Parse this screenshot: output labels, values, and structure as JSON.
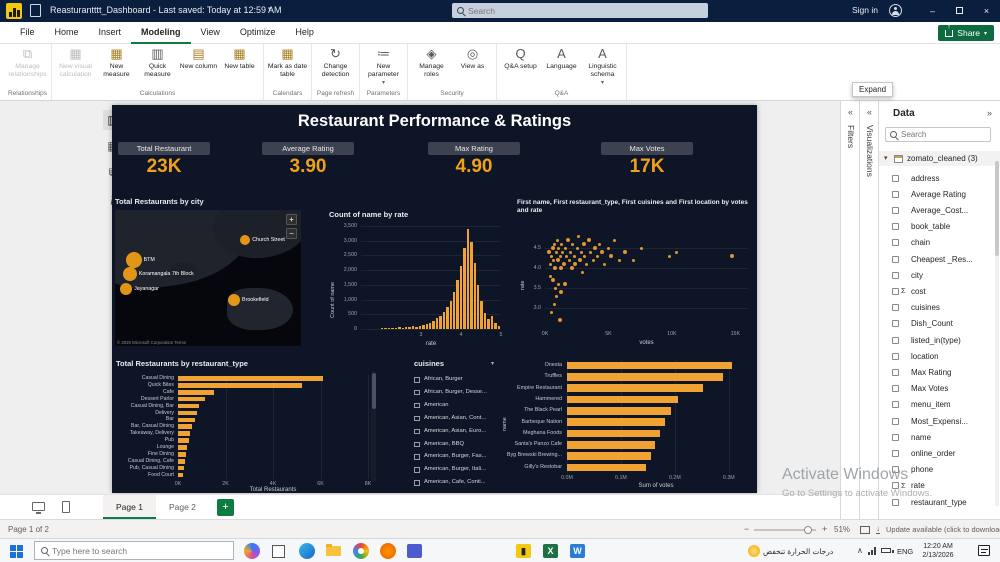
{
  "app": {
    "titlebar": {
      "title": "Reasturantttt_Dashboard - Last saved: Today at 12:59 AM",
      "search_placeholder": "Search",
      "sign_in": "Sign in"
    },
    "menu": {
      "tabs": [
        "File",
        "Home",
        "Insert",
        "Modeling",
        "View",
        "Optimize",
        "Help"
      ],
      "active_tab": "Modeling",
      "share_label": "Share"
    },
    "ribbon": {
      "groups": [
        {
          "label": "Relationships",
          "buttons": [
            {
              "label": "Manage relationships",
              "icon": "manage-relationships",
              "disabled": true
            }
          ]
        },
        {
          "label": "Calculations",
          "buttons": [
            {
              "label": "New visual calculation",
              "icon": "new-visual-calculation",
              "disabled": true
            },
            {
              "label": "New measure",
              "icon": "new-measure"
            },
            {
              "label": "Quick measure",
              "icon": "quick-measure"
            },
            {
              "label": "New column",
              "icon": "new-column"
            },
            {
              "label": "New table",
              "icon": "new-table"
            }
          ]
        },
        {
          "label": "Calendars",
          "buttons": [
            {
              "label": "Mark as date table",
              "icon": "mark-as-date-table"
            }
          ]
        },
        {
          "label": "Page refresh",
          "buttons": [
            {
              "label": "Change detection",
              "icon": "change-detection"
            }
          ]
        },
        {
          "label": "Parameters",
          "buttons": [
            {
              "label": "New parameter",
              "icon": "new-parameter",
              "dropdown": true
            }
          ]
        },
        {
          "label": "Security",
          "buttons": [
            {
              "label": "Manage roles",
              "icon": "manage-roles"
            },
            {
              "label": "View as",
              "icon": "view-as"
            }
          ]
        },
        {
          "label": "Q&A",
          "buttons": [
            {
              "label": "Q&A setup",
              "icon": "qa-setup"
            },
            {
              "label": "Language",
              "icon": "language"
            },
            {
              "label": "Linguistic schema",
              "icon": "linguistic-schema",
              "dropdown": true
            }
          ]
        }
      ]
    },
    "expand_tooltip": "Expand"
  },
  "dashboard": {
    "title": "Restaurant Performance & Ratings",
    "kpis": [
      {
        "label": "Total Restaurant",
        "value": "23K"
      },
      {
        "label": "Average Rating",
        "value": "3.90"
      },
      {
        "label": "Max Rating",
        "value": "4.90"
      },
      {
        "label": "Max Votes",
        "value": "17K"
      }
    ],
    "map": {
      "title": "Total Restaurants by city",
      "bubbles": [
        {
          "name": "Church Street",
          "x": 70,
          "y": 22,
          "r": 5
        },
        {
          "name": "BTM",
          "x": 10,
          "y": 37,
          "r": 8
        },
        {
          "name": "Koramangala 7th Block",
          "x": 8,
          "y": 47,
          "r": 7
        },
        {
          "name": "Jayanagar",
          "x": 6,
          "y": 58,
          "r": 6
        },
        {
          "name": "Brookefield",
          "x": 64,
          "y": 66,
          "r": 6
        }
      ],
      "attribution": "© 2025 Microsoft Corporation Terms"
    },
    "slicer": {
      "title": "cuisines",
      "items": [
        "African, Burger",
        "African, Burger, Desse...",
        "American",
        "American, Asian, Cont...",
        "American, Asian, Euro...",
        "American, BBQ",
        "American, Burger, Fas...",
        "American, Burger, Itali...",
        "American, Cafe, Conti..."
      ]
    }
  },
  "chart_data": [
    {
      "id": "count-of-name-by-rate",
      "type": "bar",
      "title": "Count of name by rate",
      "xlabel": "rate",
      "ylabel": "Count of name",
      "x_domain": [
        1.5,
        5.0
      ],
      "y_domain": [
        0,
        3500
      ],
      "xticks": [
        "3",
        "4",
        "5"
      ],
      "xtick_vals": [
        3,
        4,
        5
      ],
      "yticks": [
        "0",
        "500",
        "1,000",
        "1,500",
        "2,000",
        "2,500",
        "3,000",
        "3,500"
      ],
      "ytick_vals": [
        0,
        500,
        1000,
        1500,
        2000,
        2500,
        3000,
        3500
      ],
      "bar_rate_start": 2.0,
      "bar_rate_step": 0.0857,
      "values": [
        30,
        18,
        25,
        40,
        35,
        55,
        45,
        70,
        60,
        90,
        80,
        110,
        140,
        170,
        220,
        280,
        360,
        450,
        580,
        740,
        960,
        1250,
        1650,
        2150,
        2750,
        3400,
        2950,
        2250,
        1500,
        950,
        560,
        330,
        430,
        190,
        90
      ]
    },
    {
      "id": "votes-rate-scatter",
      "type": "scatter",
      "title": "First name, First restaurant_type, First cuisines and First location by votes and rate",
      "xlabel": "votes",
      "ylabel": "rate",
      "x_domain": [
        0,
        16000
      ],
      "y_domain": [
        2.5,
        5.0
      ],
      "xticks": [
        "0K",
        "5K",
        "10K",
        "15K"
      ],
      "xtick_vals": [
        0,
        5000,
        10000,
        15000
      ],
      "yticks": [
        "3.0",
        "3.5",
        "4.0",
        "4.5"
      ],
      "ytick_vals": [
        3.0,
        3.5,
        4.0,
        4.5
      ],
      "points": [
        [
          300,
          4.4
        ],
        [
          450,
          4.1
        ],
        [
          520,
          4.3
        ],
        [
          600,
          4.5
        ],
        [
          700,
          4.2
        ],
        [
          760,
          4.6
        ],
        [
          820,
          4.0
        ],
        [
          900,
          4.4
        ],
        [
          960,
          4.7
        ],
        [
          1000,
          4.2
        ],
        [
          1100,
          4.5
        ],
        [
          1200,
          4.3
        ],
        [
          1260,
          4.0
        ],
        [
          1320,
          4.6
        ],
        [
          1400,
          4.4
        ],
        [
          1500,
          4.1
        ],
        [
          1600,
          4.5
        ],
        [
          1700,
          4.3
        ],
        [
          1800,
          4.7
        ],
        [
          1900,
          4.2
        ],
        [
          2000,
          4.4
        ],
        [
          2100,
          4.0
        ],
        [
          2200,
          4.6
        ],
        [
          2300,
          4.3
        ],
        [
          2400,
          4.1
        ],
        [
          2550,
          4.5
        ],
        [
          2650,
          4.8
        ],
        [
          2750,
          4.2
        ],
        [
          2850,
          4.4
        ],
        [
          2950,
          3.9
        ],
        [
          3050,
          4.6
        ],
        [
          3150,
          4.3
        ],
        [
          3300,
          4.1
        ],
        [
          3450,
          4.7
        ],
        [
          3600,
          4.4
        ],
        [
          3800,
          4.2
        ],
        [
          3950,
          4.5
        ],
        [
          4100,
          4.3
        ],
        [
          4300,
          4.6
        ],
        [
          4500,
          4.4
        ],
        [
          4700,
          4.1
        ],
        [
          5000,
          4.5
        ],
        [
          5200,
          4.3
        ],
        [
          5500,
          4.7
        ],
        [
          5900,
          4.2
        ],
        [
          6300,
          4.4
        ],
        [
          7000,
          4.2
        ],
        [
          7600,
          4.5
        ],
        [
          600,
          3.7
        ],
        [
          820,
          3.5
        ],
        [
          1050,
          3.6
        ],
        [
          1250,
          3.4
        ],
        [
          420,
          3.8
        ],
        [
          900,
          3.3
        ],
        [
          1550,
          3.6
        ],
        [
          720,
          3.1
        ],
        [
          540,
          2.9
        ],
        [
          1150,
          2.7
        ],
        [
          9800,
          4.3
        ],
        [
          10400,
          4.4
        ],
        [
          14700,
          4.3
        ]
      ]
    },
    {
      "id": "total-restaurants-by-restaurant-type",
      "type": "bar",
      "title": "Total Restaurants by restaurant_type",
      "xlabel": "Total Restaurants",
      "ylabel": "restaurant_type",
      "x_domain": [
        0,
        8000
      ],
      "xticks": [
        "0K",
        "2K",
        "4K",
        "6K",
        "8K"
      ],
      "xtick_vals": [
        0,
        2000,
        4000,
        6000,
        8000
      ],
      "categories": [
        "Casual Dining",
        "Quick Bites",
        "Cafe",
        "Dessert Parlor",
        "Casual Dining, Bar",
        "Delivery",
        "Bar",
        "Bar, Casual Dining",
        "Takeaway, Delivery",
        "Pub",
        "Lounge",
        "Fine Dining",
        "Casual Dining, Cafe",
        "Pub, Casual Dining",
        "Food Court"
      ],
      "values": [
        6100,
        5200,
        1500,
        1150,
        900,
        790,
        700,
        600,
        520,
        450,
        380,
        330,
        280,
        240,
        200
      ]
    },
    {
      "id": "sum-of-votes-by-name",
      "type": "bar",
      "title": "",
      "xlabel": "Sum of votes",
      "ylabel": "name",
      "x_domain": [
        0,
        330000
      ],
      "xticks": [
        "0.0M",
        "0.1M",
        "0.2M",
        "0.3M"
      ],
      "xtick_vals": [
        0,
        100000,
        200000,
        300000
      ],
      "categories": [
        "Onesta",
        "Truffles",
        "Empire Restaurant",
        "Hammered",
        "The Black Pearl",
        "Barbeque Nation",
        "Meghana Foods",
        "Santa's Panzo Cafe",
        "Byg Brewski Brewing...",
        "Gilly's Restobar"
      ],
      "values": [
        305000,
        290000,
        252000,
        205000,
        193000,
        182000,
        172000,
        163000,
        155000,
        147000
      ]
    }
  ],
  "panes": {
    "filters_label": "Filters",
    "visualizations_label": "Visualizations",
    "data": {
      "title": "Data",
      "search_placeholder": "Search",
      "table_name": "zomato_cleaned (3)",
      "fields": [
        {
          "name": "address"
        },
        {
          "name": "Average Rating"
        },
        {
          "name": "Average_Cost..."
        },
        {
          "name": "book_table"
        },
        {
          "name": "chain"
        },
        {
          "name": "Cheapest _Res..."
        },
        {
          "name": "city"
        },
        {
          "name": "cost",
          "kind": "sigma"
        },
        {
          "name": "cuisines"
        },
        {
          "name": "Dish_Count"
        },
        {
          "name": "listed_in(type)"
        },
        {
          "name": "location"
        },
        {
          "name": "Max Rating"
        },
        {
          "name": "Max Votes"
        },
        {
          "name": "menu_item"
        },
        {
          "name": "Most_Expensi..."
        },
        {
          "name": "name"
        },
        {
          "name": "online_order"
        },
        {
          "name": "phone"
        },
        {
          "name": "rate",
          "kind": "sigma"
        },
        {
          "name": "restaurant_type"
        }
      ]
    }
  },
  "pages": {
    "tabs": [
      "Page 1",
      "Page 2"
    ],
    "active": "Page 1"
  },
  "statusbar": {
    "page_info": "Page 1 of 2",
    "zoom": "51%",
    "update_text": "Update available (click to download)"
  },
  "taskbar": {
    "search_placeholder": "Type here to search",
    "weather_text": "درجات الحرارة تنخفض",
    "language": "ENG",
    "time": "12:20 AM",
    "date": "2/13/2026"
  },
  "watermark": {
    "line1": "Activate Windows",
    "line2": "Go to Settings to activate Windows."
  }
}
